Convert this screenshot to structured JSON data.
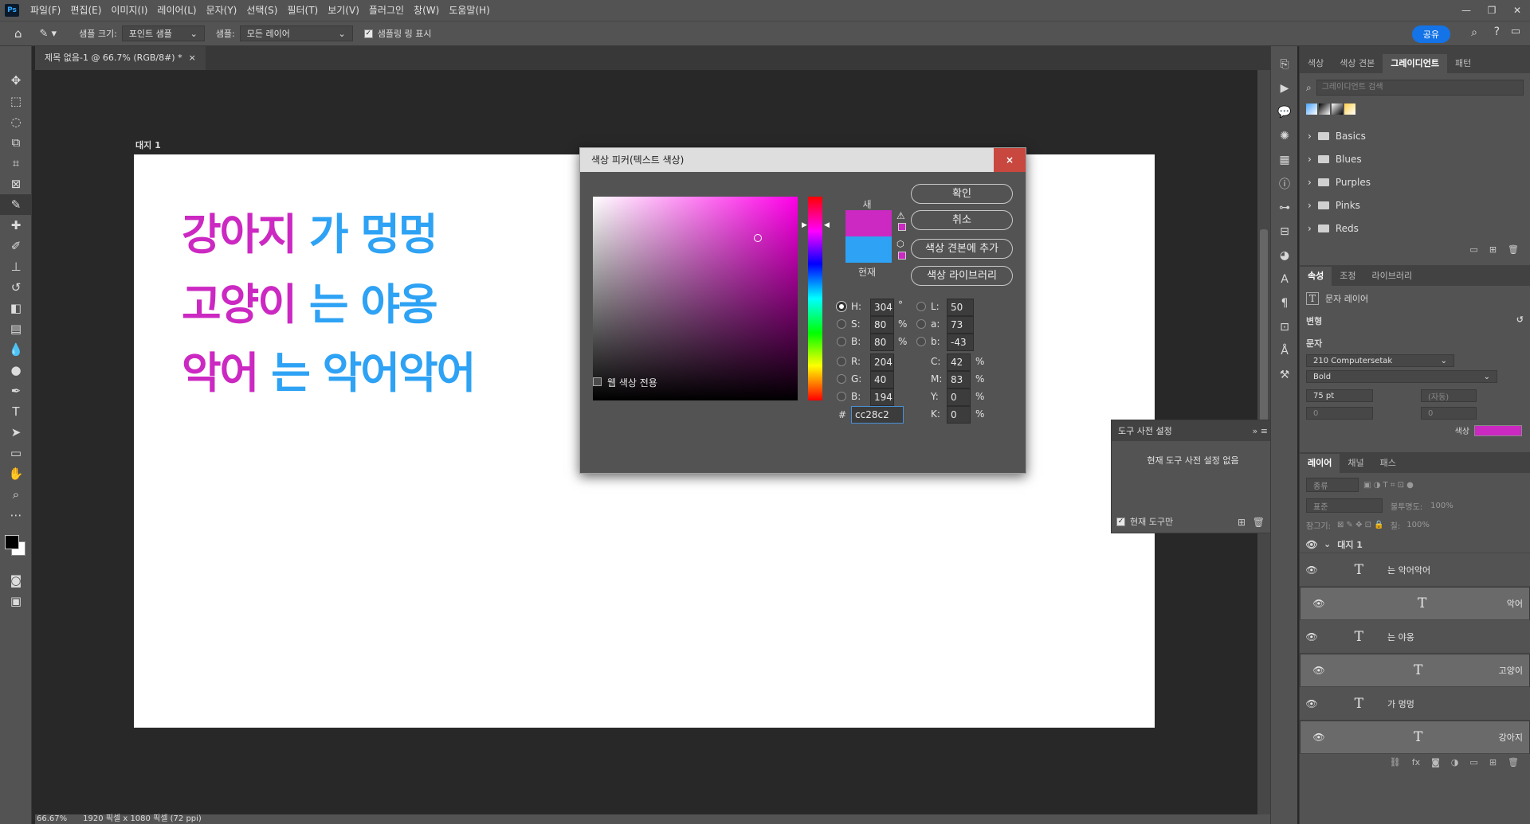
{
  "menubar": {
    "logo": "Ps",
    "items": [
      "파일(F)",
      "편집(E)",
      "이미지(I)",
      "레이어(L)",
      "문자(Y)",
      "선택(S)",
      "필터(T)",
      "보기(V)",
      "플러그인",
      "창(W)",
      "도움말(H)"
    ]
  },
  "options": {
    "sample_size_label": "샘플 크기:",
    "sample_size_value": "포인트 샘플",
    "sample_label": "샘플:",
    "sample_value": "모든 레이어",
    "show_ring_label": "샘플링 링 표시",
    "share_label": "공유"
  },
  "doc_tab": {
    "title": "제목 없음-1 @ 66.7% (RGB/8#) *",
    "close": "×"
  },
  "artboard": {
    "label": "대지 1"
  },
  "canvas_text": {
    "l1a": "강아지",
    "l1b": "가 멍멍",
    "l2a": "고양이",
    "l2b": "는 야옹",
    "l3a": "악어",
    "l3b": "는 악어악어"
  },
  "status": {
    "zoom": "66.67%",
    "size": "1920 픽셀 x 1080 픽셀 (72 ppi)"
  },
  "dialog": {
    "title": "색상 피커(텍스트 색상)",
    "close": "×",
    "ok": "확인",
    "cancel": "취소",
    "add_swatch": "색상 견본에 추가",
    "libraries": "색상 라이브러리",
    "new_label": "새",
    "current_label": "현재",
    "new_color": "#cc28c2",
    "current_color": "#2ea2f4",
    "web_only": "웹 색상 전용",
    "H": "304",
    "S": "80",
    "Bv": "80",
    "R": "204",
    "G": "40",
    "B": "194",
    "L": "50",
    "a": "73",
    "b": "-43",
    "C": "42",
    "M": "83",
    "Y": "0",
    "K": "0",
    "hex": "cc28c2",
    "deg": "°",
    "pct": "%",
    "hash": "#",
    "lbl_H": "H:",
    "lbl_S": "S:",
    "lbl_Bv": "B:",
    "lbl_R": "R:",
    "lbl_G": "G:",
    "lbl_B": "B:",
    "lbl_L": "L:",
    "lbl_a": "a:",
    "lbl_b": "b:",
    "lbl_C": "C:",
    "lbl_M": "M:",
    "lbl_Y": "Y:",
    "lbl_K": "K:"
  },
  "preset_panel": {
    "title": "도구 사전 설정",
    "empty": "현재 도구 사전 설정 없음",
    "current_only": "현재 도구만"
  },
  "gradient_panel": {
    "tabs": [
      "색상",
      "색상 견본",
      "그레이디언트",
      "패턴"
    ],
    "search_placeholder": "그레이디언트 검색",
    "groups": [
      "Basics",
      "Blues",
      "Purples",
      "Pinks",
      "Reds"
    ]
  },
  "props_panel": {
    "tabs": [
      "속성",
      "조정",
      "라이브러리"
    ],
    "layer_kind": "문자 레이어",
    "transform": "변형",
    "char": "문자",
    "font": "210 Computersetak",
    "style": "Bold",
    "size": "75 pt",
    "leading": "(자동)",
    "tracking": "0",
    "kerning": "0",
    "color_label": "색상",
    "color": "#cc28c2"
  },
  "layers_panel": {
    "tabs": [
      "레이어",
      "채널",
      "패스"
    ],
    "kind": "종류",
    "blend": "표준",
    "opacity_label": "불투명도:",
    "opacity": "100%",
    "lock_label": "잠그기:",
    "fill_label": "칠:",
    "fill": "100%",
    "artboard": "대지 1",
    "layers": [
      "는 악어악어",
      "악어",
      "는 야옹",
      "고양이",
      "가 멍멍",
      "강아지"
    ]
  }
}
